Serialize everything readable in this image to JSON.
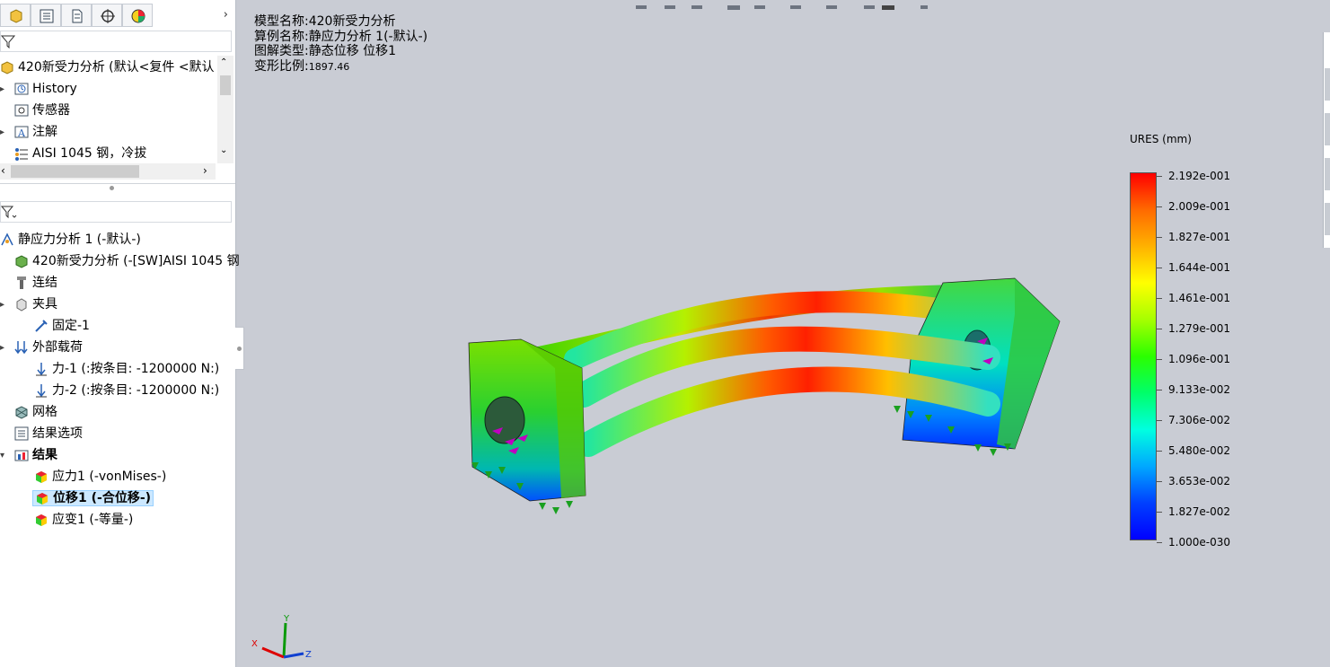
{
  "sidebar": {
    "tabs": [
      {
        "icon": "feature-manager-icon"
      },
      {
        "icon": "property-manager-icon"
      },
      {
        "icon": "configuration-manager-icon"
      },
      {
        "icon": "dimxpert-icon"
      },
      {
        "icon": "display-manager-icon"
      }
    ],
    "feature_tree": {
      "root": "420新受力分析 (默认<复件 <默认",
      "items": [
        {
          "label": "History",
          "icon": "history-icon"
        },
        {
          "label": "传感器",
          "icon": "sensor-icon"
        },
        {
          "label": "注解",
          "icon": "annotation-icon"
        },
        {
          "label": "AISI 1045 钢，冷拔",
          "icon": "material-icon"
        }
      ]
    },
    "study_tree": {
      "root": "静应力分析 1 (-默认-)",
      "items": [
        {
          "label": "420新受力分析 (-[SW]AISI 1045 钢",
          "icon": "part-icon"
        },
        {
          "label": "连结",
          "icon": "connection-icon"
        },
        {
          "label": "夹具",
          "icon": "fixture-folder-icon"
        },
        {
          "label": "固定-1",
          "icon": "fixed-icon"
        },
        {
          "label": "外部载荷",
          "icon": "external-loads-icon"
        },
        {
          "label": "力-1 (:按条目: -1200000 N:)",
          "icon": "force-icon"
        },
        {
          "label": "力-2 (:按条目: -1200000 N:)",
          "icon": "force-icon"
        },
        {
          "label": "网格",
          "icon": "mesh-icon"
        },
        {
          "label": "结果选项",
          "icon": "result-options-icon"
        },
        {
          "label": "结果",
          "icon": "results-folder-icon"
        },
        {
          "label": "应力1 (-vonMises-)",
          "icon": "stress-plot-icon"
        },
        {
          "label": "位移1 (-合位移-)",
          "icon": "displacement-plot-icon"
        },
        {
          "label": "应变1 (-等量-)",
          "icon": "strain-plot-icon"
        }
      ]
    }
  },
  "viewport": {
    "info": {
      "model_name_label": "模型名称:",
      "model_name": "420新受力分析",
      "study_name_label": "算例名称:",
      "study_name": "静应力分析 1(-默认-)",
      "plot_type_label": "图解类型:",
      "plot_type": "静态位移 位移1",
      "deform_scale_label": "变形比例:",
      "deform_scale": "1897.46"
    },
    "legend": {
      "title": "URES (mm)",
      "ticks": [
        "2.192e-001",
        "2.009e-001",
        "1.827e-001",
        "1.644e-001",
        "1.461e-001",
        "1.279e-001",
        "1.096e-001",
        "9.133e-002",
        "7.306e-002",
        "5.480e-002",
        "3.653e-002",
        "1.827e-002",
        "1.000e-030"
      ],
      "max_color": "#ff0000",
      "min_color": "#0000ff"
    },
    "triad": {
      "x": "X",
      "y": "Y",
      "z": "Z"
    }
  }
}
